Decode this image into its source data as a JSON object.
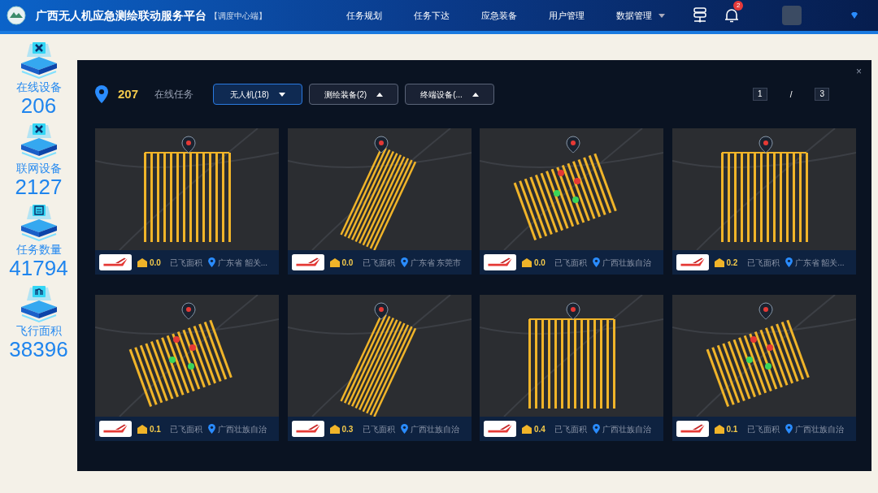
{
  "header": {
    "title": "广西无人机应急测绘联动服务平台",
    "subtitle": "【调度中心端】",
    "nav": [
      {
        "label": "任务规划",
        "dropdown": false
      },
      {
        "label": "任务下达",
        "dropdown": false
      },
      {
        "label": "应急装备",
        "dropdown": false
      },
      {
        "label": "用户管理",
        "dropdown": false
      },
      {
        "label": "数据管理",
        "dropdown": true
      }
    ],
    "notification_count": "2"
  },
  "stats": [
    {
      "label": "在线设备",
      "value": "206"
    },
    {
      "label": "联网设备",
      "value": "2127"
    },
    {
      "label": "任务数量",
      "value": "41794"
    },
    {
      "label": "飞行面积",
      "value": "38396"
    }
  ],
  "panel": {
    "close": "×",
    "count": "207",
    "count_label": "在线任务",
    "filters": [
      {
        "label": "无人机(18)",
        "selected": true
      },
      {
        "label": "测绘装备(2)",
        "selected": false
      },
      {
        "label": "终端设备(...",
        "selected": false
      }
    ],
    "page": "1",
    "page_separator": "/",
    "page_total": "3",
    "cards": [
      {
        "area": "0.0",
        "area_label": "已飞面积",
        "location": "广东省 韶关..."
      },
      {
        "area": "0.0",
        "area_label": "已飞面积",
        "location": "广东省 东莞市"
      },
      {
        "area": "0.0",
        "area_label": "已飞面积",
        "location": "广西壮族自治"
      },
      {
        "area": "0.2",
        "area_label": "已飞面积",
        "location": "广东省 韶关..."
      },
      {
        "area": "0.1",
        "area_label": "已飞面积",
        "location": "广西壮族自治"
      },
      {
        "area": "0.3",
        "area_label": "已飞面积",
        "location": "广西壮族自治"
      },
      {
        "area": "0.4",
        "area_label": "已飞面积",
        "location": "广西壮族自治"
      },
      {
        "area": "0.1",
        "area_label": "已飞面积",
        "location": "广西壮族自治"
      }
    ]
  }
}
